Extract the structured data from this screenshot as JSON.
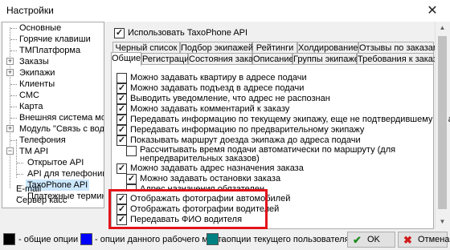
{
  "window": {
    "title": "Настройки",
    "close_glyph": "✕"
  },
  "tree": {
    "items": [
      {
        "label": "Основные"
      },
      {
        "label": "Горячие клавиши"
      },
      {
        "label": "ТМПлатформа"
      },
      {
        "label": "Заказы"
      },
      {
        "label": "Экипажи"
      },
      {
        "label": "Клиенты"
      },
      {
        "label": "СМС"
      },
      {
        "label": "Карта"
      },
      {
        "label": "Внешняя система монитор"
      },
      {
        "label": "Модуль \"Связь с водителя"
      },
      {
        "label": "Телефония"
      },
      {
        "label": "TM API"
      },
      {
        "label": "Открытое API"
      },
      {
        "label": "API для телефонии"
      },
      {
        "label": "TaxoPhone API"
      },
      {
        "label": "Платежные терминалі"
      },
      {
        "label": "E-mail"
      },
      {
        "label": "Сервер касс"
      }
    ]
  },
  "main": {
    "use_checkbox_label": "Использовать TaxoPhone API",
    "tabs_row1": [
      "Черный список",
      "Подбор экипажей",
      "Рейтинги",
      "Холдирование",
      "Отзывы по заказам"
    ],
    "tabs_row2": [
      "Общие",
      "Регистрация",
      "Состояния заказа",
      "Описание",
      "Группы экипажей",
      "Требования к заказу"
    ],
    "options": [
      {
        "label": "Можно задавать квартиру в адресе подачи",
        "checked": false
      },
      {
        "label": "Можно задавать подъезд в адресе подачи",
        "checked": true
      },
      {
        "label": "Выводить уведомление, что адрес не распознан",
        "checked": true
      },
      {
        "label": "Можно задавать комментарий к заказу",
        "checked": true
      },
      {
        "label": "Передавать информацию по текущему экипажу, еще не подтвердившему заказ",
        "checked": true
      },
      {
        "label": "Передавать информацию по предварительному экипажу",
        "checked": true
      },
      {
        "label": "Показывать маршрут доезда экипажа до адреса подачи",
        "checked": true
      },
      {
        "label": "Рассчитывать время подачи автоматически по маршруту (для",
        "label2": "непредварительных заказов)",
        "checked": false
      },
      {
        "label": "Можно задавать адрес назначения заказа",
        "checked": true
      },
      {
        "label": "Можно задавать остановки заказа",
        "checked": true
      },
      {
        "label": "Адрес назначения обязателен",
        "checked": false
      },
      {
        "label": "Отображать фотографии автомобилей",
        "checked": true
      },
      {
        "label": "Отображать фотографии водителей",
        "checked": true
      },
      {
        "label": "Передавать ФИО водителя",
        "checked": true
      }
    ]
  },
  "legend": {
    "items": [
      {
        "color": "#000000",
        "text": "- общие опции"
      },
      {
        "color": "#0000ff",
        "text": "- опции данного рабочего места"
      },
      {
        "color": "#008080",
        "text": "- опции текущего пользователя"
      }
    ]
  },
  "buttons": {
    "ok": "OK",
    "cancel": "Отмена",
    "ok_icon": "✔",
    "cancel_icon": "✖"
  },
  "colors": {
    "highlight_border": "#e2141c",
    "tree_selection": "#cce8ff"
  }
}
